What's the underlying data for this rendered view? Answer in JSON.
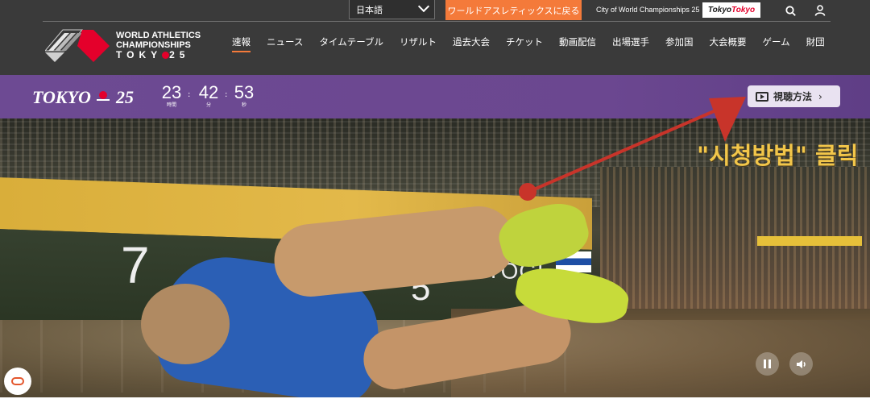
{
  "header": {
    "language": "日本語",
    "tagline_button": "ワールドアスレティックスに戻る",
    "city_label": "City of World Championships 25",
    "tokyo_badge_left": "Tokyo",
    "tokyo_badge_right": "Tokyo",
    "logo_lines": [
      "WORLD ATHLETICS",
      "CHAMPIONSHIPS"
    ],
    "logo_tokyo": "TOKY",
    "logo_year": "25",
    "nav": [
      "速報",
      "ニュース",
      "タイムテーブル",
      "リザルト",
      "過去大会",
      "チケット",
      "動画配信",
      "出場選手",
      "参加国",
      "大会概要",
      "ゲーム",
      "財団"
    ]
  },
  "countdown": {
    "brand": "TOKYO",
    "brand_year": "25",
    "hours": "23",
    "hours_unit": "時間",
    "minutes": "42",
    "minutes_unit": "分",
    "seconds": "53",
    "seconds_unit": "秒",
    "watch_button": "視聴方法"
  },
  "hero": {
    "lane_left": "7",
    "lane_right": "5",
    "athlete_name": "TENTOGL",
    "annotation": "\"시청방법\" 클릭"
  },
  "colors": {
    "topbar": "#3a3a3a",
    "accent_orange": "#f47a3a",
    "purple": "#6d4a93",
    "brand_red": "#e4002b",
    "annotation_yellow": "#f2c64a",
    "arrow_red": "#c8342a"
  },
  "icons": [
    "chevron-down-icon",
    "search-icon",
    "user-icon",
    "tv-play-icon",
    "chevron-right-icon",
    "pause-icon",
    "volume-icon",
    "chat-icon"
  ]
}
